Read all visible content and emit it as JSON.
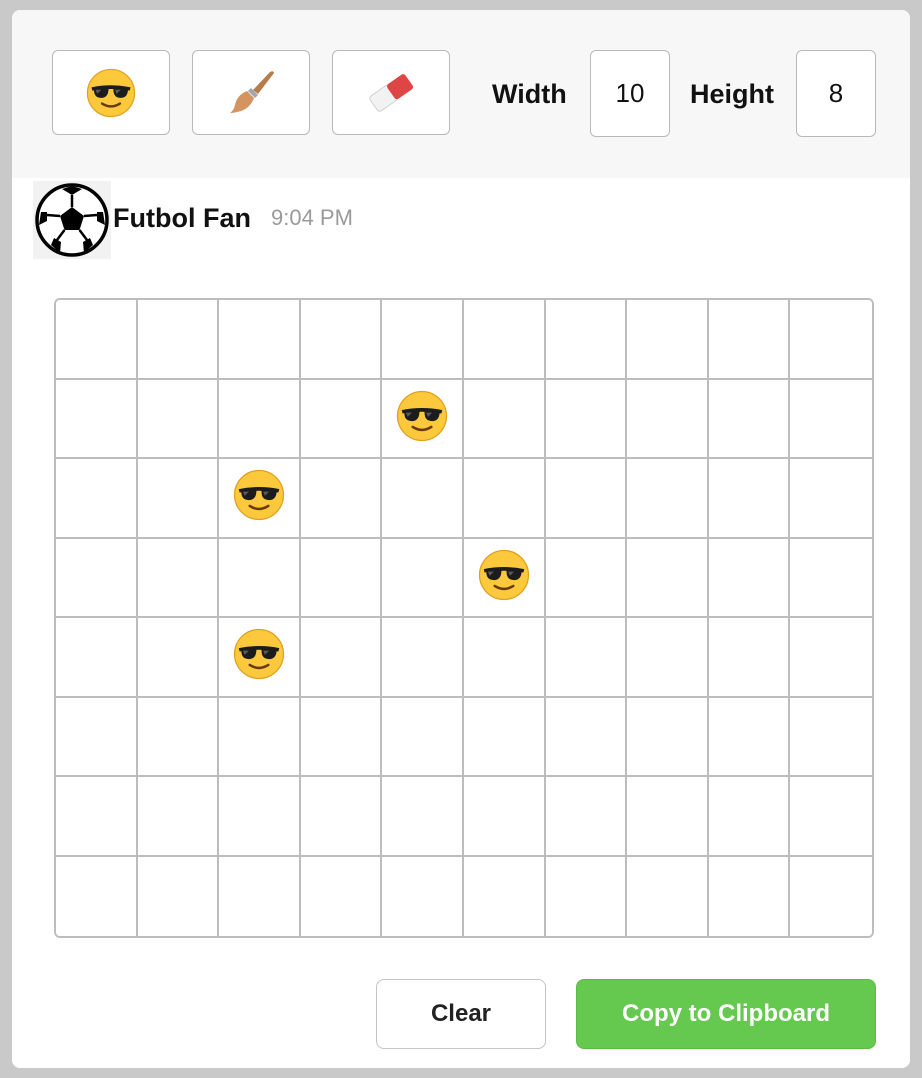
{
  "toolbar": {
    "tools": [
      {
        "name": "emoji-picker",
        "icon": "smiling-face-with-sunglasses-icon"
      },
      {
        "name": "paint-brush",
        "icon": "paint-brush-icon"
      },
      {
        "name": "eraser",
        "icon": "eraser-icon"
      }
    ],
    "width_label": "Width",
    "width_value": "10",
    "height_label": "Height",
    "height_value": "8"
  },
  "message": {
    "avatar_icon": "soccer-ball-icon",
    "username": "Futbol Fan",
    "timestamp": "9:04 PM"
  },
  "grid": {
    "columns": 10,
    "rows": 8,
    "filled_emoji": "smiling-face-with-sunglasses",
    "filled_cells": [
      {
        "row": 1,
        "col": 4
      },
      {
        "row": 2,
        "col": 2
      },
      {
        "row": 3,
        "col": 5
      },
      {
        "row": 4,
        "col": 2
      }
    ]
  },
  "actions": {
    "clear_label": "Clear",
    "copy_label": "Copy to Clipboard"
  },
  "colors": {
    "primary_green": "#66c94f",
    "toolbar_bg": "#f7f7f7",
    "border": "#bdbdbd",
    "timestamp_gray": "#9a9a9a"
  }
}
